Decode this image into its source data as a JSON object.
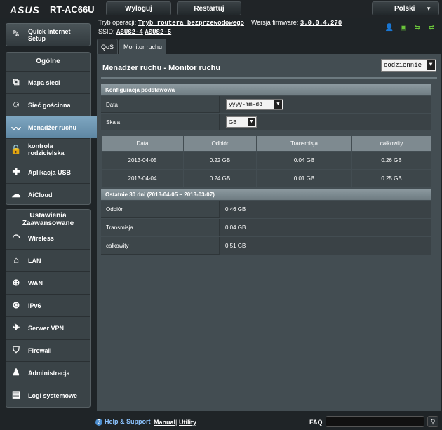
{
  "header": {
    "logo": "ASUS",
    "model": "RT-AC66U",
    "logout_label": "Wyloguj",
    "restart_label": "Restartuj",
    "language": "Polski"
  },
  "info": {
    "mode_label": "Tryb operacji:",
    "mode_value": "Tryb routera bezprzewodowego",
    "firmware_label": "Wersja firmware:",
    "firmware_value": "3.0.0.4.270",
    "ssid_label": "SSID:",
    "ssid_1": "ASUS2-4",
    "ssid_2": "ASUS2-5"
  },
  "sidebar": {
    "qis_label": "Quick Internet Setup",
    "general_title": "Ogólne",
    "general_items": [
      {
        "label": "Mapa sieci"
      },
      {
        "label": "Sieć gościnna"
      },
      {
        "label": "Menadżer ruchu"
      },
      {
        "label": "kontrola rodzicielska"
      },
      {
        "label": "Aplikacja USB"
      },
      {
        "label": "AiCloud"
      }
    ],
    "advanced_title": "Ustawienia Zaawansowane",
    "advanced_items": [
      {
        "label": "Wireless"
      },
      {
        "label": "LAN"
      },
      {
        "label": "WAN"
      },
      {
        "label": "IPv6"
      },
      {
        "label": "Serwer VPN"
      },
      {
        "label": "Firewall"
      },
      {
        "label": "Administracja"
      },
      {
        "label": "Logi systemowe"
      }
    ]
  },
  "tabs": [
    {
      "label": "QoS"
    },
    {
      "label": "Monitor ruchu"
    }
  ],
  "main": {
    "title": "Menadżer ruchu - Monitor ruchu",
    "period": "codziennie",
    "config_title": "Konfiguracja podstawowa",
    "date_label": "Data",
    "date_value": "yyyy-mm-dd",
    "scale_label": "Skala",
    "scale_value": "GB",
    "table": {
      "headers": [
        "Data",
        "Odbiór",
        "Transmisja",
        "całkowity"
      ],
      "rows": [
        [
          "2013-04-05",
          "0.22 GB",
          "0.04 GB",
          "0.26 GB"
        ],
        [
          "2013-04-04",
          "0.24 GB",
          "0.01 GB",
          "0.25 GB"
        ]
      ]
    },
    "last30_title": "Ostatnie 30 dni (2013-04-05 ~ 2013-03-07)",
    "summary": [
      {
        "label": "Odbiór",
        "value": "0.46 GB"
      },
      {
        "label": "Transmisja",
        "value": "0.04 GB"
      },
      {
        "label": "całkowity",
        "value": "0.51 GB"
      }
    ]
  },
  "footer": {
    "help": "Help & Support",
    "manual": "Manual",
    "separator": "|",
    "utility": "Utility",
    "faq": "FAQ"
  },
  "colors": {
    "accent": "#5e87a3",
    "status_green": "#69c33a",
    "panel": "#434d52"
  }
}
